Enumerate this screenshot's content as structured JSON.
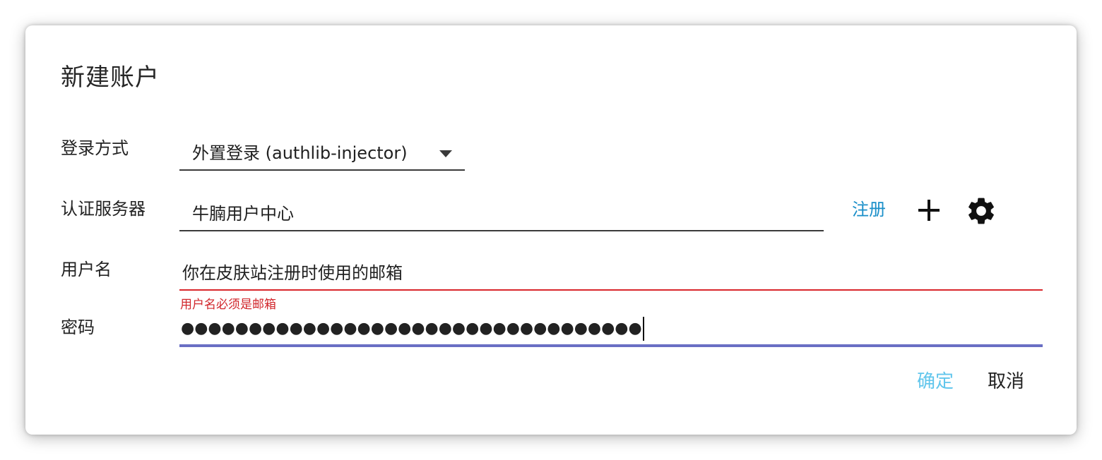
{
  "dialog": {
    "title": "新建账户"
  },
  "login_method": {
    "label": "登录方式",
    "selected": "外置登录 (authlib-injector)"
  },
  "auth_server": {
    "label": "认证服务器",
    "value": "牛腩用户中心",
    "register_label": "注册",
    "add_icon": "plus-icon",
    "settings_icon": "gear-icon"
  },
  "username": {
    "label": "用户名",
    "value": "你在皮肤站注册时使用的邮箱",
    "error": "用户名必须是邮箱"
  },
  "password": {
    "label": "密码",
    "masked_value": "●●●●●●●●●●●●●●●●●●●●●●●●●●●●●●●●●●"
  },
  "actions": {
    "ok_label": "确定",
    "cancel_label": "取消"
  },
  "colors": {
    "link": "#1a8fc9",
    "error": "#d1262b",
    "focus_underline": "#6a6fc4",
    "ok_button": "#62c6ec"
  }
}
